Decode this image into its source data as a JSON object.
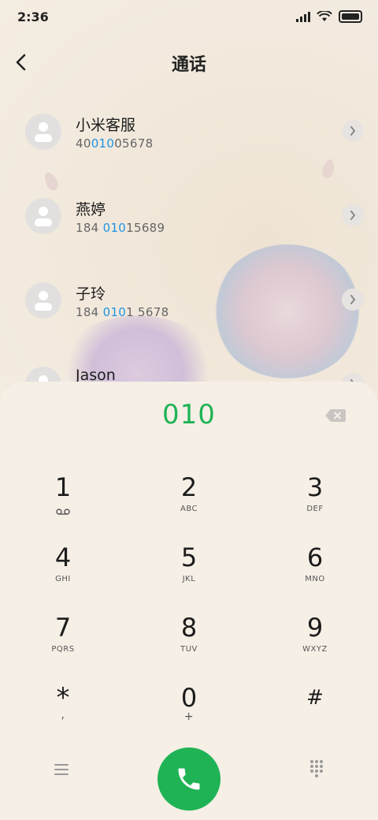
{
  "status": {
    "time": "2:36",
    "icons": [
      "signal-icon",
      "wifi-icon",
      "battery-icon"
    ]
  },
  "header": {
    "title": "通话",
    "back_icon": "chevron-left-icon"
  },
  "contacts": [
    {
      "name": "小米客服",
      "number_pre": "40",
      "number_hl": "010",
      "number_post": "05678"
    },
    {
      "name": "燕婷",
      "number_pre": "184 ",
      "number_hl": "010",
      "number_post": "15689"
    },
    {
      "name": "子玲",
      "number_pre": "184 ",
      "number_hl": "010",
      "number_post": "1 5678"
    },
    {
      "name": "Jason",
      "number_pre": "",
      "number_hl": "",
      "number_post": ""
    }
  ],
  "dialpad": {
    "entered": "010",
    "keys": [
      {
        "digit": "1",
        "letters": "voicemail-icon"
      },
      {
        "digit": "2",
        "letters": "ABC"
      },
      {
        "digit": "3",
        "letters": "DEF"
      },
      {
        "digit": "4",
        "letters": "GHI"
      },
      {
        "digit": "5",
        "letters": "JKL"
      },
      {
        "digit": "6",
        "letters": "MNO"
      },
      {
        "digit": "7",
        "letters": "PQRS"
      },
      {
        "digit": "8",
        "letters": "TUV"
      },
      {
        "digit": "9",
        "letters": "WXYZ"
      },
      {
        "digit": "*",
        "letters": ","
      },
      {
        "digit": "0",
        "letters": "+"
      },
      {
        "digit": "#",
        "letters": ""
      }
    ]
  },
  "colors": {
    "accent_green": "#1fb356",
    "highlight_blue": "#1f93e0",
    "background": "#f3ece1"
  }
}
